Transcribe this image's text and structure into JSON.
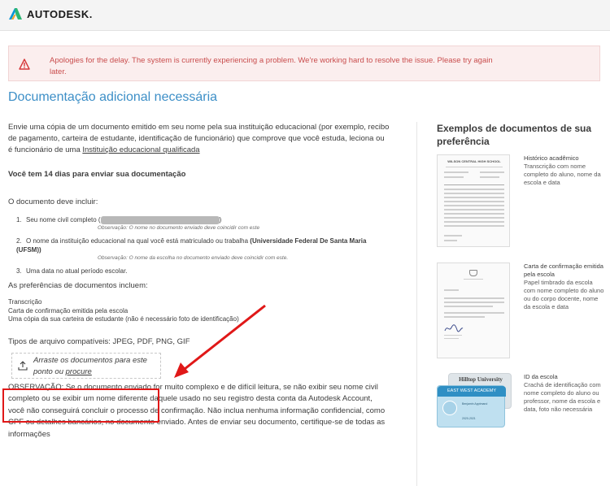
{
  "header": {
    "brand": "AUTODESK",
    "brand_suffix": ".",
    "logo_icon": "autodesk-logo-icon"
  },
  "alert": {
    "icon": "warning-triangle-icon",
    "text": "Apologies for the delay. The system is currently experiencing a problem. We're working hard to resolve the issue. Please try again later.",
    "color": "#c94d4d"
  },
  "page": {
    "title": "Documentação adicional necessária"
  },
  "main": {
    "intro_before_link": "Envie uma cópia de um documento emitido em seu nome pela sua instituição educacional (por exemplo, recibo de pagamento, carteira de estudante, identificação de funcionário) que comprove que você estuda, leciona ou é funcionário de uma ",
    "intro_link": "Instituição educacional qualificada",
    "deadline": "Você tem 14 dias para enviar sua documentação",
    "must_include": "O documento deve incluir:",
    "requirements": [
      {
        "num": "1.",
        "text": "Seu nome civil completo (",
        "text_after": ")",
        "note": "Observação: O nome no documento enviado deve coincidir com este"
      },
      {
        "num": "2.",
        "text": "O nome da instituição educacional na qual você está matriculado ou trabalha ",
        "bold": "(Universidade Federal De Santa Maria (UFSM))",
        "note": "Observação: O nome da escolha no documento enviado deve coincidir com este."
      },
      {
        "num": "3.",
        "text": "Uma data no atual período escolar."
      }
    ],
    "prefs_heading": "As preferências de documentos incluem:",
    "prefs": [
      "Transcrição",
      "Carta de confirmação emitida pela escola",
      "Uma cópia da sua carteira de estudante (não é necessário foto de identificação)"
    ],
    "filetypes": "Tipos de arquivo compatíveis: JPEG, PDF, PNG, GIF",
    "dropzone": {
      "icon": "upload-icon",
      "text_before": "Arraste os documentos para este ponto ou ",
      "link": "procure"
    },
    "observation": "OBSERVAÇÃO: Se o documento enviado for muito complexo e de difícil leitura, se não exibir seu nome civil completo ou se exibir um nome diferente daquele usado no seu registro desta conta da Autodesk Account, você não conseguirá concluir o processo de confirmação. Não inclua nenhuma informação confidencial, como CPF ou detalhes bancários, no documento enviado. Antes de enviar seu documento, certifique-se de todas as informações"
  },
  "sidebar": {
    "title": "Exemplos de documentos de sua preferência",
    "examples": [
      {
        "title": "Histórico acadêmico",
        "desc": "Transcrição com nome completo do aluno, nome da escola e data",
        "thumb_heading": "WILSON CENTRAL HIGH SCHOOL"
      },
      {
        "title": "Carta de confirmação emitida pela escola",
        "desc": "Papel timbrado da escola com nome completo do aluno ou do corpo docente, nome da escola e data"
      },
      {
        "title": "ID da escola",
        "desc": "Crachá de identificação com nome completo do aluno ou professor, nome da escola e data, foto não necessária",
        "card_back_name": "Hilltop University",
        "card_front_name": "EAST WEST ACADEMY",
        "card_person": "Benjamin Apptmand",
        "card_date": "2020-2021"
      }
    ]
  },
  "colors": {
    "title_blue": "#3d8fc7",
    "annotation_red": "#e01818",
    "alert_bg": "#fbeeee"
  }
}
